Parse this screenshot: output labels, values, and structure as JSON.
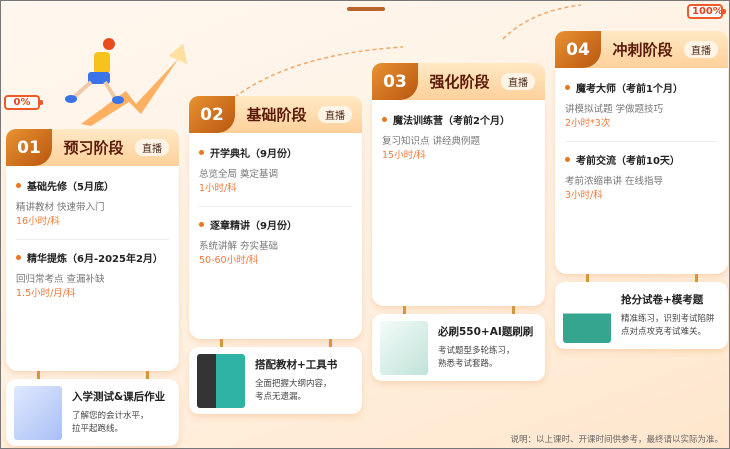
{
  "progress_start": "0%",
  "progress_end": "100%",
  "stages": [
    {
      "num": "01",
      "title": "预习阶段",
      "badge": "直播",
      "items": [
        {
          "title": "基础先修（5月底）",
          "desc": "精讲教材 快速带入门",
          "hours": "16小时/科"
        },
        {
          "title": "精华提炼（6月-2025年2月）",
          "desc": "回归常考点 查漏补缺",
          "hours": "1.5小时/月/科"
        }
      ],
      "extra": {
        "title": "入学测试&课后作业",
        "desc1": "了解您的会计水平，",
        "desc2": "拉平起跑线。"
      }
    },
    {
      "num": "02",
      "title": "基础阶段",
      "badge": "直播",
      "items": [
        {
          "title": "开学典礼（9月份）",
          "desc": "总览全局 奠定基调",
          "hours": "1小时/科"
        },
        {
          "title": "逐章精讲（9月份）",
          "desc": "系统讲解 夯实基础",
          "hours": "50-60小时/科"
        }
      ],
      "extra": {
        "title": "搭配教材+工具书",
        "desc1": "全面把握大纲内容，",
        "desc2": "考点无遗漏。"
      }
    },
    {
      "num": "03",
      "title": "强化阶段",
      "badge": "直播",
      "items": [
        {
          "title": "魔法训练营（考前2个月）",
          "desc": "复习知识点 讲经典例题",
          "hours": "15小时/科"
        }
      ],
      "extra": {
        "title": "必刷550+AI题刷刷",
        "desc1": "考试题型多轮练习，",
        "desc2": "熟悉考试套路。"
      }
    },
    {
      "num": "04",
      "title": "冲刺阶段",
      "badge": "直播",
      "items": [
        {
          "title": "魔考大师（考前1个月）",
          "desc": "讲模拟试题 学做题技巧",
          "hours": "2小时*3次"
        },
        {
          "title": "考前交流（考前10天）",
          "desc": "考前浓缩串讲 在线指导",
          "hours": "3小时/科"
        }
      ],
      "extra": {
        "title": "抢分试卷+模考题",
        "desc1": "精准练习，识别考试陷阱",
        "desc2": "点对点攻克考试难关。"
      }
    }
  ],
  "note": "说明：以上课时、开课时间供参考，最终请以实际为准。"
}
